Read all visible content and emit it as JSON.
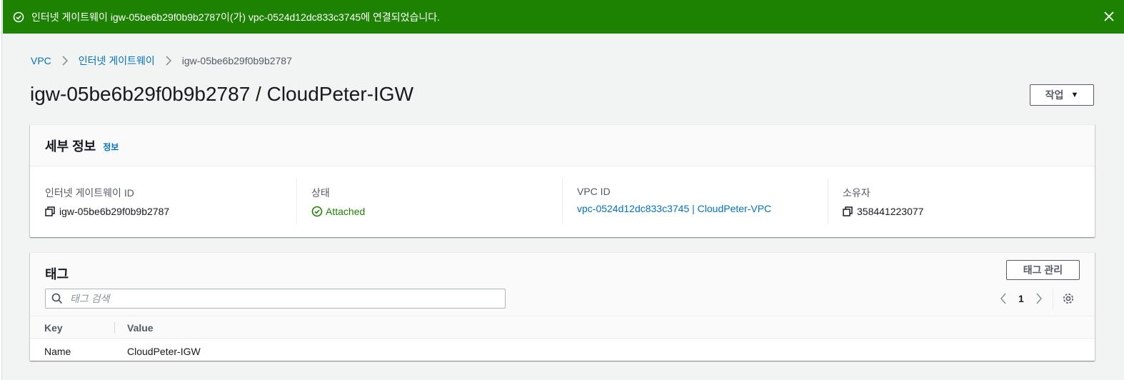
{
  "flash": {
    "message": "인터넷 게이트웨이 igw-05be6b29f0b9b2787이(가) vpc-0524d12dc833c3745에 연결되었습니다.",
    "color": "#1d8102"
  },
  "breadcrumb": {
    "items": [
      "VPC",
      "인터넷 게이트웨이"
    ],
    "current": "igw-05be6b29f0b9b2787"
  },
  "page_title": "igw-05be6b29f0b9b2787 / CloudPeter-IGW",
  "actions_label": "작업",
  "details": {
    "title": "세부 정보",
    "info_link": "정보",
    "columns": [
      {
        "label": "인터넷 게이트웨이 ID",
        "value": "igw-05be6b29f0b9b2787"
      },
      {
        "label": "상태",
        "value": "Attached"
      },
      {
        "label": "VPC ID",
        "value": "vpc-0524d12dc833c3745 | CloudPeter-VPC"
      },
      {
        "label": "소유자",
        "value": "358441223077"
      }
    ]
  },
  "tags": {
    "title": "태그",
    "manage_label": "태그 관리",
    "search_placeholder": "태그 검색",
    "page_number": "1",
    "columns": [
      "Key",
      "Value"
    ],
    "rows": [
      {
        "key": "Name",
        "value": "CloudPeter-IGW"
      }
    ]
  },
  "icons": {
    "flash": "check-circle-icon",
    "close": "close-icon",
    "copy": "copy-icon",
    "status": "status-positive-icon",
    "search": "search-icon",
    "prev": "chevron-left-icon",
    "next": "chevron-right-icon",
    "settings": "gear-icon"
  }
}
